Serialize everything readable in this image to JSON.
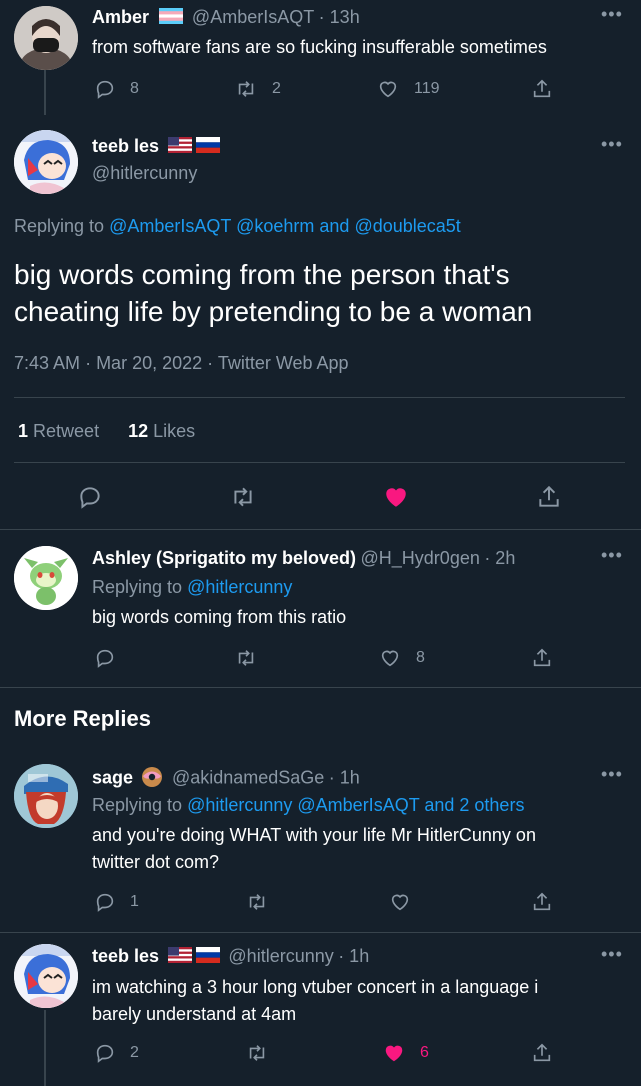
{
  "colors": {
    "background": "#15202b",
    "text": "#ffffff",
    "muted": "#8b98a5",
    "link": "#1d9bf0",
    "like": "#f91880",
    "divider": "#38444d"
  },
  "tweet1": {
    "name": "Amber",
    "handle": "@AmberIsAQT",
    "time": "· 13h",
    "text": "from software fans are so fucking insufferable sometimes",
    "replies": "8",
    "retweets": "2",
    "likes": "119"
  },
  "main": {
    "name": "teeb les",
    "handle": "@hitlercunny",
    "replying_prefix": "Replying to",
    "replying_links": [
      "@AmberIsAQT",
      "@koehrm",
      "and",
      "@doubleca5t"
    ],
    "text": "big words coming from the person that's cheating life by pretending to be a woman",
    "time": "7:43 AM",
    "date": "Mar 20, 2022",
    "source": "Twitter Web App",
    "retweet_count": "1",
    "retweet_label": "Retweet",
    "like_count": "12",
    "like_label": "Likes"
  },
  "reply1": {
    "name": "Ashley (Sprigatito my beloved)",
    "handle": "@H_Hydr0gen",
    "time": "· 2h",
    "replying_prefix": "Replying to",
    "replying_link": "@hitlercunny",
    "text": "big words coming from this ratio",
    "likes": "8"
  },
  "more_replies_label": "More Replies",
  "reply2": {
    "name": "sage",
    "handle": "@akidnamedSaGe",
    "time": "· 1h",
    "replying_prefix": "Replying to",
    "replying_link": "@hitlercunny @AmberIsAQT and 2 others",
    "text_line1": "and you're doing WHAT with your life Mr HitlerCunny on",
    "text_line2": "twitter dot com?",
    "replies": "1"
  },
  "reply3": {
    "name": "teeb les",
    "handle": "@hitlercunny",
    "time": "· 1h",
    "text_line1": "im watching a 3 hour long vtuber concert in a language i",
    "text_line2": "barely understand at 4am",
    "replies": "2",
    "likes": "6"
  }
}
